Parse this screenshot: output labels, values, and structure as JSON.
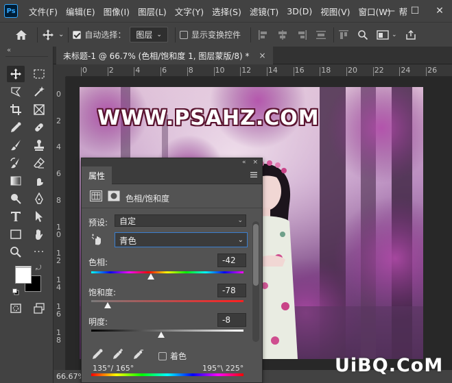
{
  "app": {
    "logo": "Ps"
  },
  "menubar": {
    "items": [
      "文件(F)",
      "编辑(E)",
      "图像(I)",
      "图层(L)",
      "文字(Y)",
      "选择(S)",
      "滤镜(T)",
      "3D(D)",
      "视图(V)",
      "窗口(W)",
      "帮"
    ],
    "window_controls": [
      "minimize-icon",
      "maximize-icon",
      "close-icon"
    ]
  },
  "options_bar": {
    "auto_select_label": "自动选择：",
    "auto_select_checked": true,
    "target_value": "图层",
    "show_transform_label": "显示变换控件",
    "show_transform_checked": false
  },
  "document": {
    "tab_title": "未标题-1 @ 66.7% (色相/饱和度 1, 图层蒙版/8) *",
    "close_glyph": "×",
    "watermark": "WWW.PSAHZ.COM"
  },
  "ruler": {
    "top_labels": [
      "0",
      "2",
      "4",
      "6",
      "8",
      "10",
      "12",
      "14",
      "16",
      "18",
      "20",
      "22",
      "24",
      "26"
    ],
    "left_labels": [
      "0",
      "2",
      "4",
      "6",
      "8",
      "1\n0",
      "1\n2",
      "1\n4",
      "1\n6",
      "1\n8"
    ]
  },
  "status": {
    "zoom": "66.67%"
  },
  "corner_watermark": "UiBQ.CoM",
  "properties": {
    "tab_label": "属性",
    "collapse_glyph": "«",
    "close_glyph": "×",
    "adjustment_title": "色相/饱和度",
    "preset_label": "预设:",
    "preset_value": "自定",
    "channel_value": "青色",
    "hue_label": "色相:",
    "hue_value": "-42",
    "saturation_label": "饱和度:",
    "saturation_value": "-78",
    "lightness_label": "明度:",
    "lightness_value": "-8",
    "colorize_label": "着色",
    "colorize_checked": false,
    "range_left": "135°/ 165°",
    "range_right": "195°\\ 225°",
    "sliders": {
      "hue_fraction": 0.39,
      "saturation_fraction": 0.11,
      "lightness_fraction": 0.46
    }
  },
  "colors": {
    "foreground": "#ffffff",
    "background": "#000000",
    "accent": "#31a8ff"
  }
}
